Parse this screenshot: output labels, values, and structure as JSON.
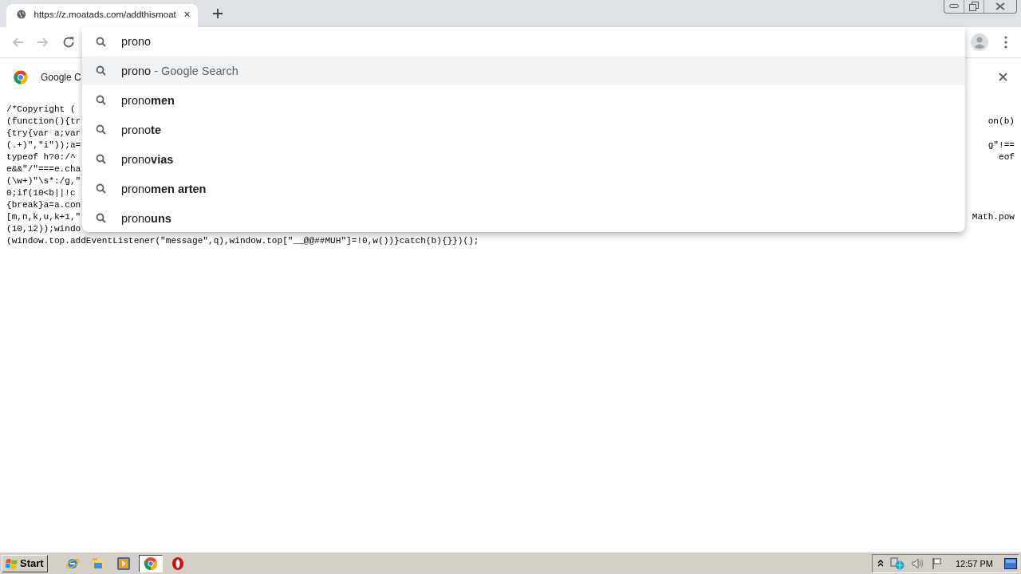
{
  "tabs": [
    {
      "title": "https://z.moatads.com/addthismoat",
      "selected": true
    }
  ],
  "toolbar": {
    "back_disabled": true,
    "forward_disabled": true
  },
  "omnibox": {
    "value": "prono"
  },
  "suggestions": [
    {
      "text": "prono",
      "hint": "- Google Search",
      "selected": true
    },
    {
      "text": "prono**men**",
      "selected": false
    },
    {
      "text": "prono**te**",
      "selected": false
    },
    {
      "text": "prono**vias**",
      "selected": false
    },
    {
      "text": "prono**men arten**",
      "selected": false
    },
    {
      "text": "prono**uns**",
      "selected": false
    }
  ],
  "infobar": {
    "text": "Google C"
  },
  "code_lines": [
    {
      "left": "/*Copyright ("
    },
    {
      "left": "(function(){tr",
      "right": "on(b)"
    },
    {
      "left": "{try{var a;var"
    },
    {
      "left": "(.+)\",\"i\"));a=",
      "right": "g\"!=="
    },
    {
      "left": "typeof h?0:/^",
      "right": "eof"
    },
    {
      "left": "e&&\"/\"===e.cha"
    },
    {
      "left": "(\\w+)\"\\s*:/g,\""
    },
    {
      "left": "0;if(10<b||!c"
    },
    {
      "left": "{break}a=a.con"
    },
    {
      "left": "[m,n,k,u,k+1,\"",
      "right": "Math.pow"
    },
    {
      "left": "(10,12));windo"
    },
    {
      "left": "(window.top.addEventListener(\"message\",q),window.top[\"__@@##MUH\"]=!0,w())}catch(b){}})();"
    }
  ],
  "taskbar": {
    "start": "Start",
    "apps": [
      {
        "kind": "ie",
        "selected": false
      },
      {
        "kind": "folder",
        "selected": false
      },
      {
        "kind": "media",
        "selected": false
      },
      {
        "kind": "chrome",
        "selected": true
      },
      {
        "kind": "opera",
        "selected": false
      }
    ],
    "clock": "12:57 PM"
  }
}
